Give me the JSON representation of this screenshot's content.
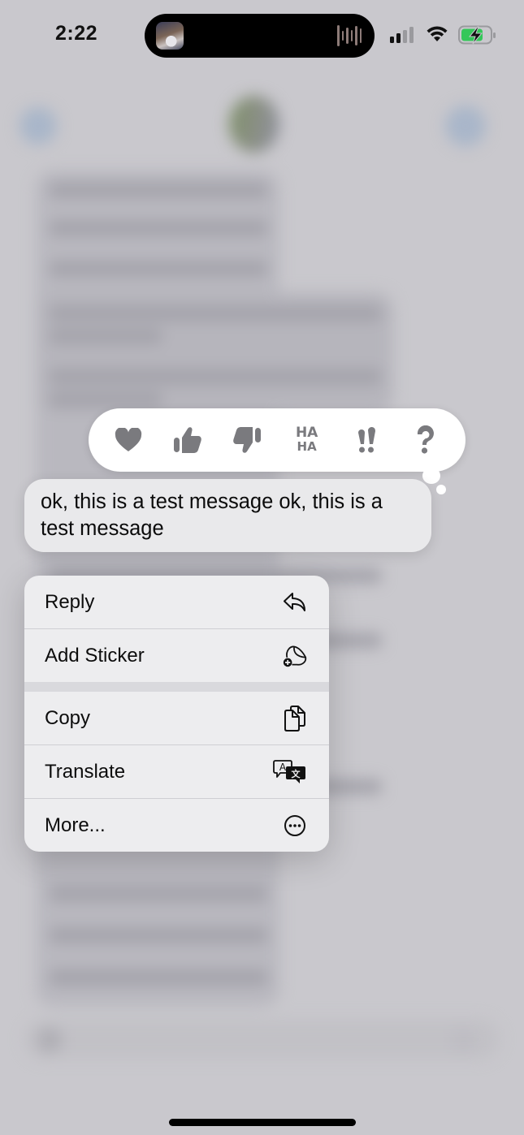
{
  "status_bar": {
    "time": "2:22",
    "battery_color": "#34c759",
    "signal_bars_active": 2,
    "signal_bars_total": 4
  },
  "reactions": [
    {
      "name": "heart",
      "label": "Love"
    },
    {
      "name": "thumbs-up",
      "label": "Like"
    },
    {
      "name": "thumbs-down",
      "label": "Dislike"
    },
    {
      "name": "haha",
      "label": "HA HA",
      "top": "HA",
      "bottom": "HA"
    },
    {
      "name": "exclamation",
      "label": "!!"
    },
    {
      "name": "question",
      "label": "?"
    }
  ],
  "message": {
    "text": "ok, this is a test message ok, this is a test message"
  },
  "menu": {
    "items": [
      {
        "label": "Reply",
        "icon": "reply-arrow-icon"
      },
      {
        "label": "Add Sticker",
        "icon": "add-sticker-icon"
      },
      {
        "label": "Copy",
        "icon": "copy-documents-icon"
      },
      {
        "label": "Translate",
        "icon": "translate-bubbles-icon"
      },
      {
        "label": "More...",
        "icon": "ellipsis-circle-icon"
      }
    ]
  },
  "colors": {
    "reaction_icon": "#7a7a7e",
    "menu_background": "#ededef",
    "bubble_background": "#e9e9eb"
  }
}
